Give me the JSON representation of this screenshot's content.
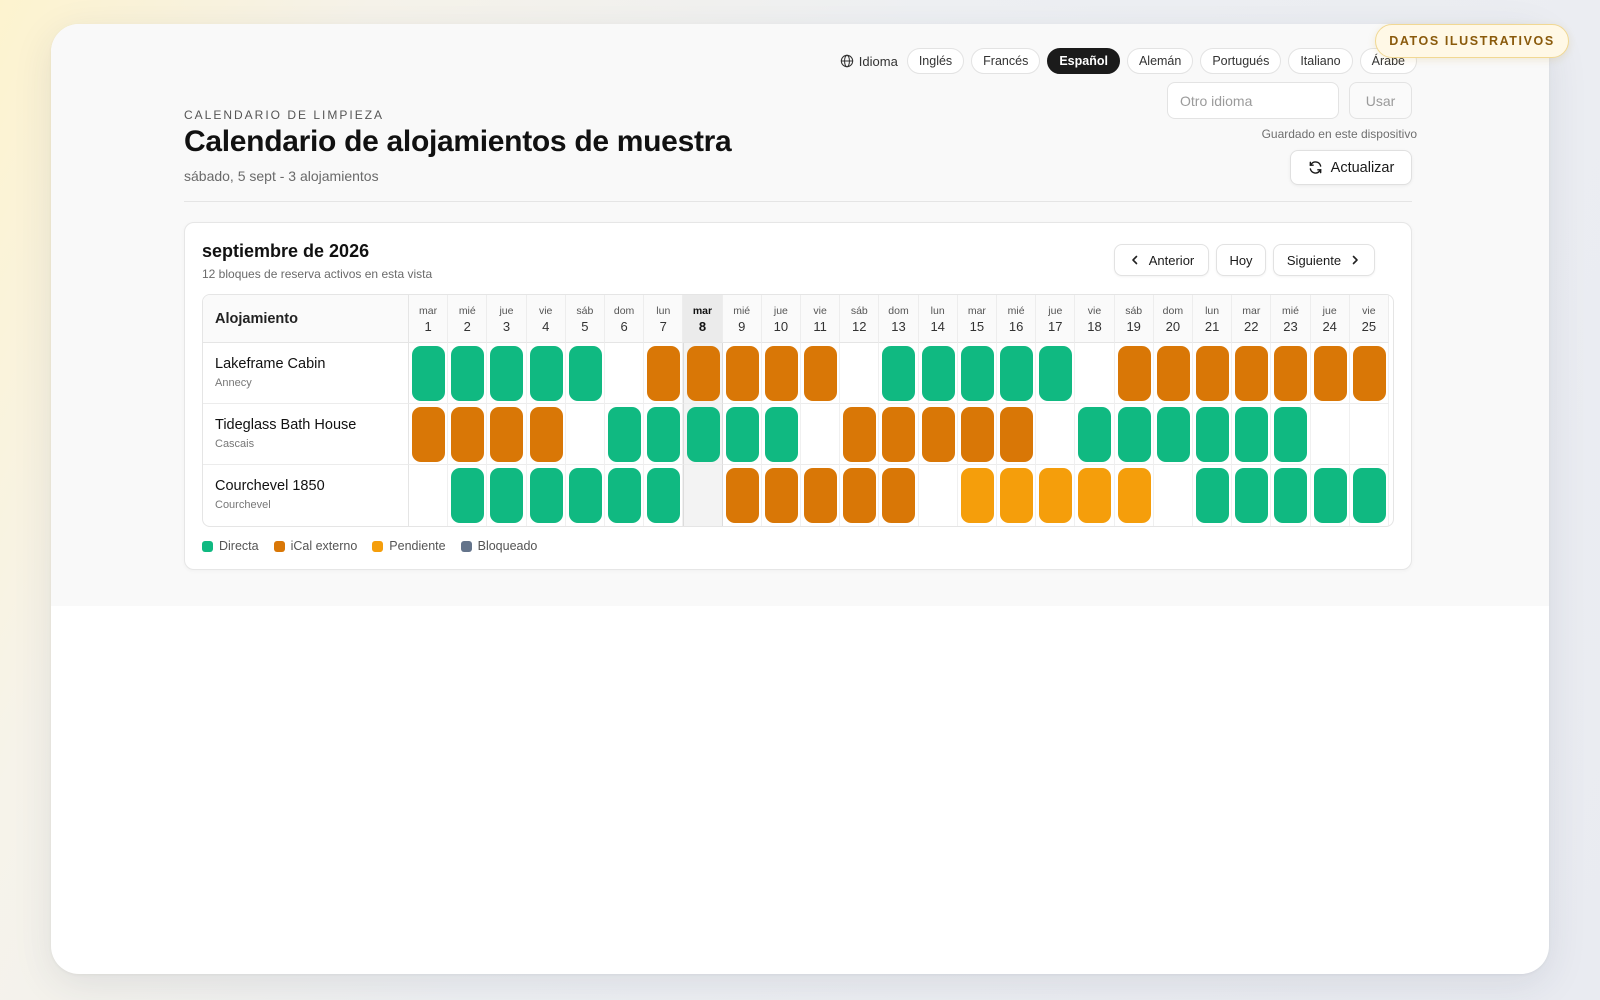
{
  "badge": "DATOS ILUSTRATIVOS",
  "language": {
    "label": "Idioma",
    "options": [
      "Inglés",
      "Francés",
      "Español",
      "Alemán",
      "Portugués",
      "Italiano",
      "Árabe"
    ],
    "active": "Español",
    "other_placeholder": "Otro idioma",
    "use_label": "Usar",
    "saved_note": "Guardado en este dispositivo"
  },
  "refresh_label": "Actualizar",
  "header": {
    "eyebrow": "CALENDARIO DE LIMPIEZA",
    "title": "Calendario de alojamientos de muestra",
    "subtitle": "sábado, 5 sept - 3 alojamientos"
  },
  "calendar": {
    "month": "septiembre de 2026",
    "active_note": "12 bloques de reserva activos en esta vista",
    "nav": {
      "prev": "Anterior",
      "today": "Hoy",
      "next": "Siguiente"
    },
    "column_header": "Alojamiento",
    "today_index": 7,
    "days": [
      {
        "dow": "mar",
        "num": "1"
      },
      {
        "dow": "mié",
        "num": "2"
      },
      {
        "dow": "jue",
        "num": "3"
      },
      {
        "dow": "vie",
        "num": "4"
      },
      {
        "dow": "sáb",
        "num": "5"
      },
      {
        "dow": "dom",
        "num": "6"
      },
      {
        "dow": "lun",
        "num": "7"
      },
      {
        "dow": "mar",
        "num": "8"
      },
      {
        "dow": "mié",
        "num": "9"
      },
      {
        "dow": "jue",
        "num": "10"
      },
      {
        "dow": "vie",
        "num": "11"
      },
      {
        "dow": "sáb",
        "num": "12"
      },
      {
        "dow": "dom",
        "num": "13"
      },
      {
        "dow": "lun",
        "num": "14"
      },
      {
        "dow": "mar",
        "num": "15"
      },
      {
        "dow": "mié",
        "num": "16"
      },
      {
        "dow": "jue",
        "num": "17"
      },
      {
        "dow": "vie",
        "num": "18"
      },
      {
        "dow": "sáb",
        "num": "19"
      },
      {
        "dow": "dom",
        "num": "20"
      },
      {
        "dow": "lun",
        "num": "21"
      },
      {
        "dow": "mar",
        "num": "22"
      },
      {
        "dow": "mié",
        "num": "23"
      },
      {
        "dow": "jue",
        "num": "24"
      },
      {
        "dow": "vie",
        "num": "25"
      }
    ],
    "properties": [
      {
        "name": "Lakeframe Cabin",
        "city": "Annecy",
        "cells": [
          "D",
          "D",
          "D",
          "D",
          "D",
          "",
          "E",
          "E",
          "E",
          "E",
          "E",
          "",
          "D",
          "D",
          "D",
          "D",
          "D",
          "",
          "E",
          "E",
          "E",
          "E",
          "E",
          "E",
          "E"
        ]
      },
      {
        "name": "Tideglass Bath House",
        "city": "Cascais",
        "cells": [
          "E",
          "E",
          "E",
          "E",
          "",
          "D",
          "D",
          "D",
          "D",
          "D",
          "",
          "E",
          "E",
          "E",
          "E",
          "E",
          "",
          "D",
          "D",
          "D",
          "D",
          "D",
          "D",
          "",
          ""
        ]
      },
      {
        "name": "Courchevel 1850",
        "city": "Courchevel",
        "cells": [
          "",
          "D",
          "D",
          "D",
          "D",
          "D",
          "D",
          "",
          "E",
          "E",
          "E",
          "E",
          "E",
          "",
          "P",
          "P",
          "P",
          "P",
          "P",
          "",
          "D",
          "D",
          "D",
          "D",
          "D"
        ]
      }
    ],
    "legend": [
      {
        "key": "D",
        "label": "Directa",
        "color": "#10b981"
      },
      {
        "key": "E",
        "label": "iCal externo",
        "color": "#d97706"
      },
      {
        "key": "P",
        "label": "Pendiente",
        "color": "#f59e0b"
      },
      {
        "key": "B",
        "label": "Bloqueado",
        "color": "#64748b"
      }
    ]
  }
}
